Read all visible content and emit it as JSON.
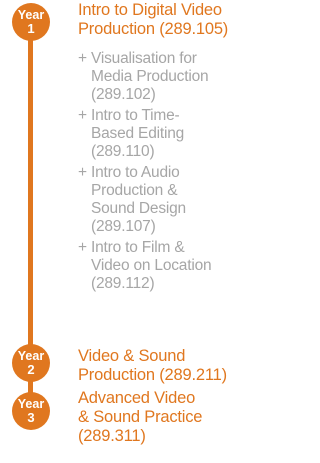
{
  "years": [
    {
      "label": "Year",
      "number": "1",
      "title_lines": [
        "Intro to Digital Video",
        "Production (289.105)"
      ]
    },
    {
      "label": "Year",
      "number": "2",
      "title_lines": [
        "Video & Sound",
        "Production (289.211)"
      ]
    },
    {
      "label": "Year",
      "number": "3",
      "title_lines": [
        "Advanced Video",
        "& Sound Practice",
        "(289.311)"
      ]
    }
  ],
  "year1_courses": [
    {
      "prefix": "+",
      "lines": [
        "Visualisation for",
        "Media Production",
        "(289.102)"
      ]
    },
    {
      "prefix": "+",
      "lines": [
        "Intro to Time-",
        "Based Editing",
        "(289.110)"
      ]
    },
    {
      "prefix": "+",
      "lines": [
        "Intro to Audio",
        "Production &",
        "Sound Design",
        "(289.107)"
      ]
    },
    {
      "prefix": "+",
      "lines": [
        "Intro to Film &",
        "Video on Location",
        "(289.112)"
      ]
    }
  ],
  "colors": {
    "accent": "#e0771f",
    "muted_text": "#a6a6a6"
  }
}
